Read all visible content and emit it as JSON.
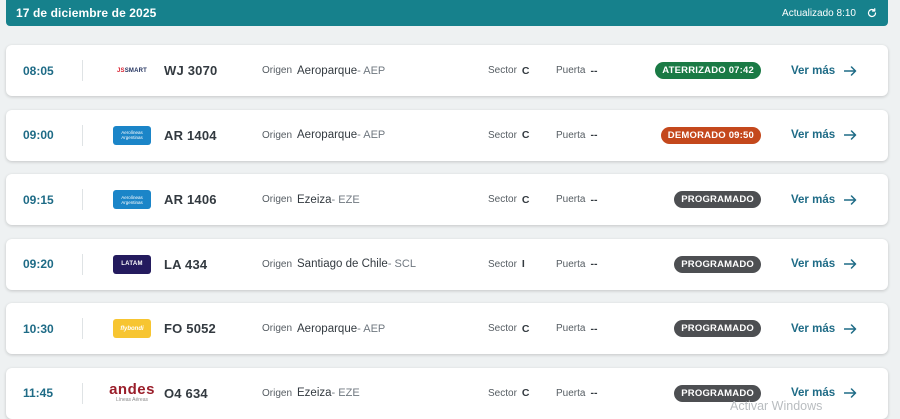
{
  "header": {
    "date": "17 de diciembre de 2025",
    "updated": "Actualizado 8:10",
    "refresh_icon": "refresh-icon"
  },
  "labels": {
    "origin": "Origen",
    "sector": "Sector",
    "gate": "Puerta",
    "more": "Ver más"
  },
  "flights": [
    {
      "time": "08:05",
      "airline": "jetsmart",
      "logo_text": "SMART",
      "flight": "WJ 3070",
      "city": "Aeroparque",
      "code": " - AEP",
      "sector": "C",
      "gate": "--",
      "status": "ATERRIZADO 07:42",
      "status_color": "#1a7a45"
    },
    {
      "time": "09:00",
      "airline": "aerolineas-argentinas",
      "logo_text": "Aerolíneas Argentinas",
      "flight": "AR 1404",
      "city": "Aeroparque",
      "code": " - AEP",
      "sector": "C",
      "gate": "--",
      "status": "DEMORADO 09:50",
      "status_color": "#c4481c"
    },
    {
      "time": "09:15",
      "airline": "aerolineas-argentinas",
      "logo_text": "Aerolíneas Argentinas",
      "flight": "AR 1406",
      "city": "Ezeiza",
      "code": " - EZE",
      "sector": "C",
      "gate": "--",
      "status": "PROGRAMADO",
      "status_color": "#4d4f52"
    },
    {
      "time": "09:20",
      "airline": "latam",
      "logo_text": "LATAM",
      "flight": "LA 434",
      "city": "Santiago de Chile",
      "code": " - SCL",
      "sector": "I",
      "gate": "--",
      "status": "PROGRAMADO",
      "status_color": "#4d4f52"
    },
    {
      "time": "10:30",
      "airline": "flybondi",
      "logo_text": "flybondi",
      "flight": "FO 5052",
      "city": "Aeroparque",
      "code": " - AEP",
      "sector": "C",
      "gate": "--",
      "status": "PROGRAMADO",
      "status_color": "#4d4f52"
    },
    {
      "time": "11:45",
      "airline": "andes",
      "logo_text": "andes",
      "logo_subtext": "Líneas Aéreas",
      "flight": "O4 634",
      "city": "Ezeiza",
      "code": " - EZE",
      "sector": "C",
      "gate": "--",
      "status": "PROGRAMADO",
      "status_color": "#4d4f52"
    }
  ],
  "watermark": "Activar Windows"
}
